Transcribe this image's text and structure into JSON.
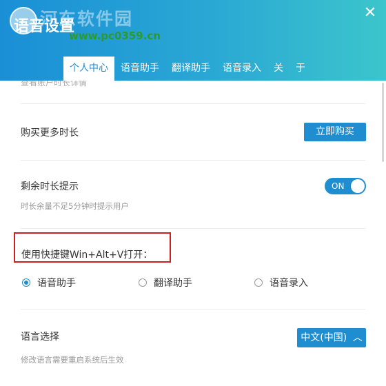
{
  "header": {
    "title": "语音设置",
    "watermark_title": "河东软件园",
    "watermark_url": "www.pc0359.cn",
    "close_glyph": "✕",
    "tabs": [
      {
        "label": "个人中心",
        "active": true
      },
      {
        "label": "语音助手",
        "active": false
      },
      {
        "label": "翻译助手",
        "active": false
      },
      {
        "label": "语音录入",
        "active": false
      },
      {
        "label": "关",
        "active": false
      },
      {
        "label": "于",
        "active": false
      }
    ]
  },
  "settings": {
    "cut_text": "查看账户时长详情",
    "buy_more": {
      "label": "购买更多时长",
      "button": "立即购买"
    },
    "remaining_reminder": {
      "label": "剩余时长提示",
      "toggle": "ON",
      "sub": "时长余量不足5分钟时提示用户"
    },
    "shortcut": {
      "label": "使用快捷键Win+Alt+V打开：",
      "options": [
        {
          "label": "语音助手",
          "checked": true
        },
        {
          "label": "翻译助手",
          "checked": false
        },
        {
          "label": "语音录入",
          "checked": false
        }
      ]
    },
    "language": {
      "label": "语言选择",
      "value": "中文(中国)",
      "sub": "修改语言需要重启系统后生效"
    }
  },
  "colors": {
    "accent": "#1e8ed0",
    "highlight_border": "#cc1f1f"
  }
}
